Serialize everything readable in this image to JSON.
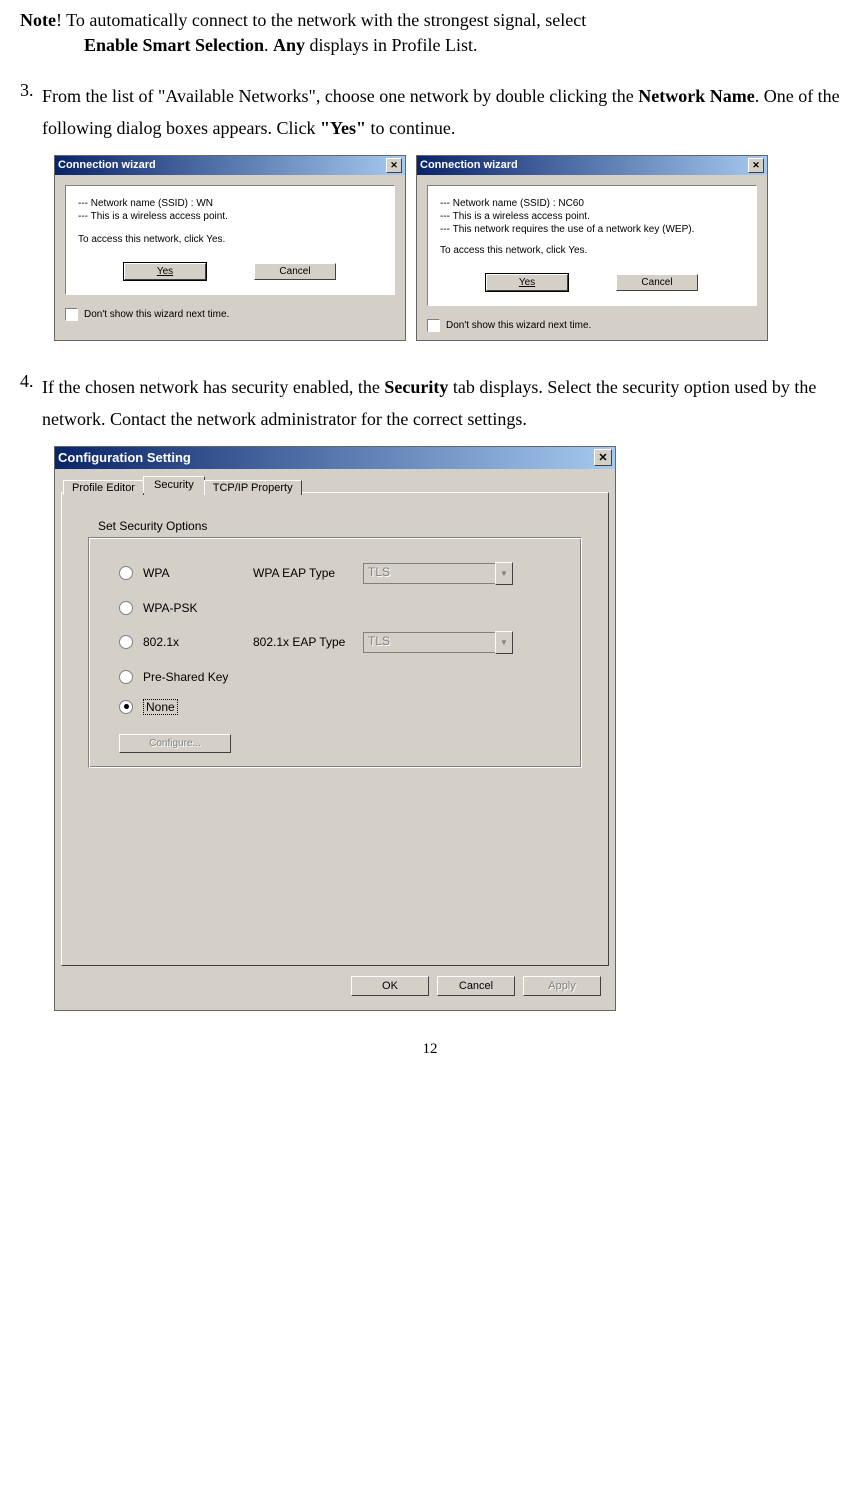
{
  "note": {
    "prefix": "Note",
    "line1_rest": "! To automatically connect to the network with the strongest signal, select",
    "line2_bold": "Enable Smart Selection",
    "line2_mid": ". ",
    "line2_bold2": "Any",
    "line2_rest": " displays in Profile List."
  },
  "step3": {
    "num": "3.",
    "text1": "From the list of \"Available Networks\", choose one network by double clicking the ",
    "bold1": "Network Name",
    "text2": ".    One of the following dialog boxes appears.    Click ",
    "bold2": "\"Yes\"",
    "text3": " to continue."
  },
  "wiz1": {
    "title": "Connection wizard",
    "l1": "--- Network name (SSID) : WN",
    "l2": "--- This is a wireless access point.",
    "l3": "To access this network, click Yes.",
    "yes": "Yes",
    "cancel": "Cancel",
    "chk": "Don't show this wizard next time."
  },
  "wiz2": {
    "title": "Connection wizard",
    "l1": "--- Network name (SSID) : NC60",
    "l2": "--- This is a wireless access point.",
    "l3": "--- This network requires the use of a network key (WEP).",
    "l4": "To access this network, click Yes.",
    "yes": "Yes",
    "cancel": "Cancel",
    "chk": "Don't show this wizard next time."
  },
  "step4": {
    "num": "4.",
    "text1": "If the chosen network has security enabled, the ",
    "bold1": "Security",
    "text2": " tab displays. Select the security option used by the network. Contact the network administrator for the correct settings."
  },
  "config": {
    "title": "Configuration Setting",
    "tabs": {
      "t1": "Profile Editor",
      "t2": "Security",
      "t3": "TCP/IP Property"
    },
    "groupLabel": "Set Security Options",
    "opts": {
      "wpa": "WPA",
      "wpapsk": "WPA-PSK",
      "dot1x": "802.1x",
      "psk": "Pre-Shared Key",
      "none": "None"
    },
    "eap1_label": "WPA EAP Type",
    "eap2_label": "802.1x EAP Type",
    "combo_val": "TLS",
    "configure": "Configure...",
    "ok": "OK",
    "cancel": "Cancel",
    "apply": "Apply"
  },
  "page_num": "12"
}
